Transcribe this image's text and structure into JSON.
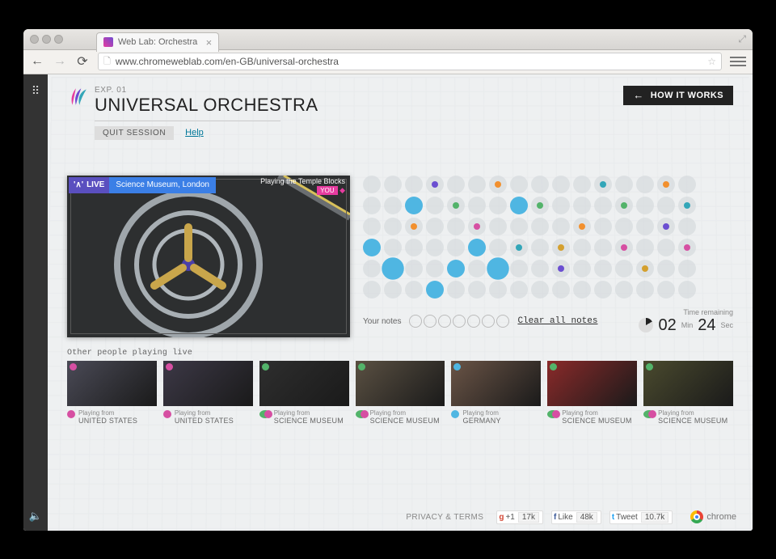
{
  "browser": {
    "tab_title": "Web Lab: Orchestra",
    "url": "www.chromeweblab.com/en-GB/universal-orchestra"
  },
  "header": {
    "exp_label": "EXP. 01",
    "title": "UNIVERSAL ORCHESTRA",
    "how_it_works": "HOW IT WORKS"
  },
  "subnav": {
    "quit": "QUIT SESSION",
    "help": "Help"
  },
  "video": {
    "live_badge": "LIVE",
    "live_location": "Science Museum, London",
    "playing_line": "Playing the Temple Blocks",
    "you_tag": "YOU"
  },
  "sequencer": {
    "rows": 6,
    "cols": 16,
    "your_notes_label": "Your notes",
    "note_slots": 7,
    "clear_label": "Clear all notes",
    "time_label": "Time remaining",
    "minutes": "02",
    "min_unit": "Min",
    "seconds": "24",
    "sec_unit": "Sec",
    "big_cells": [
      [
        0,
        3
      ],
      [
        1,
        4
      ],
      [
        2,
        1
      ],
      [
        3,
        5
      ],
      [
        4,
        4
      ],
      [
        5,
        3
      ],
      [
        6,
        4
      ],
      [
        7,
        1
      ]
    ],
    "dots": [
      {
        "c": 2,
        "r": 2,
        "color": "orange"
      },
      {
        "c": 3,
        "r": 0,
        "color": "purple"
      },
      {
        "c": 4,
        "r": 1,
        "color": "green"
      },
      {
        "c": 5,
        "r": 2,
        "color": "pink"
      },
      {
        "c": 6,
        "r": 0,
        "color": "orange"
      },
      {
        "c": 7,
        "r": 3,
        "color": "teal"
      },
      {
        "c": 8,
        "r": 1,
        "color": "green"
      },
      {
        "c": 9,
        "r": 3,
        "color": "gold"
      },
      {
        "c": 9,
        "r": 4,
        "color": "purple"
      },
      {
        "c": 10,
        "r": 2,
        "color": "orange"
      },
      {
        "c": 11,
        "r": 0,
        "color": "teal"
      },
      {
        "c": 12,
        "r": 3,
        "color": "pink"
      },
      {
        "c": 12,
        "r": 1,
        "color": "green"
      },
      {
        "c": 13,
        "r": 4,
        "color": "gold"
      },
      {
        "c": 14,
        "r": 2,
        "color": "purple"
      },
      {
        "c": 14,
        "r": 0,
        "color": "orange"
      },
      {
        "c": 15,
        "r": 3,
        "color": "pink"
      },
      {
        "c": 15,
        "r": 1,
        "color": "teal"
      }
    ]
  },
  "others": {
    "label": "Other people playing live",
    "playing_from_label": "Playing from",
    "players": [
      {
        "location": "UNITED STATES",
        "color": "#d64fa2",
        "bg": "#4a4a56"
      },
      {
        "location": "UNITED STATES",
        "color": "#d64fa2",
        "bg": "#3c3846"
      },
      {
        "location": "SCIENCE MUSEUM",
        "color": "#53b36a",
        "color2": "#d64fa2",
        "bg": "#2e2e2e"
      },
      {
        "location": "SCIENCE MUSEUM",
        "color": "#53b36a",
        "color2": "#d64fa2",
        "bg": "#5a5042"
      },
      {
        "location": "GERMANY",
        "color": "#4fb6e2",
        "bg": "#6a5446"
      },
      {
        "location": "SCIENCE MUSEUM",
        "color": "#53b36a",
        "color2": "#d64fa2",
        "bg": "#8a2a2a"
      },
      {
        "location": "SCIENCE MUSEUM",
        "color": "#53b36a",
        "color2": "#d64fa2",
        "bg": "#4a4a2e"
      }
    ]
  },
  "footer": {
    "privacy": "PRIVACY & TERMS",
    "gplus_count": "17k",
    "fb_label": "Like",
    "fb_count": "48k",
    "tw_label": "Tweet",
    "tw_count": "10.7k",
    "chrome_label": "chrome"
  }
}
